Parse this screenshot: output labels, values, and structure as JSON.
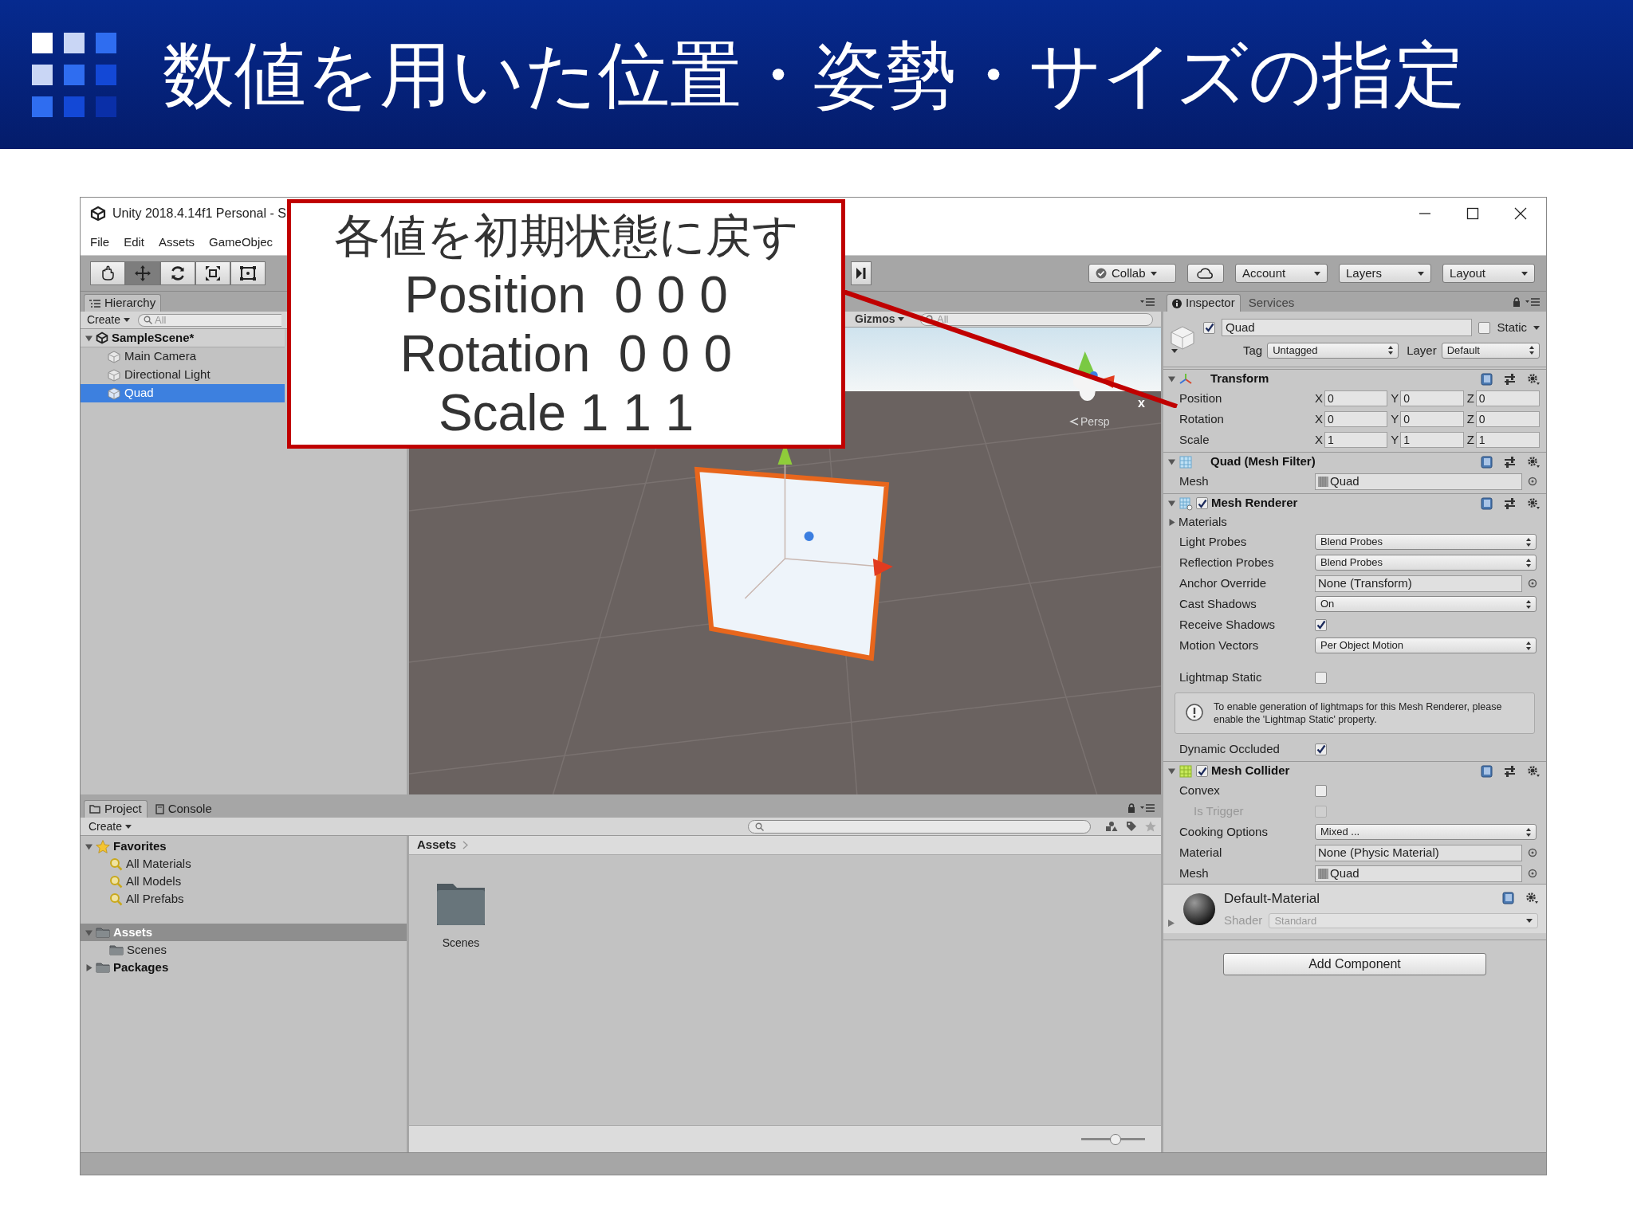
{
  "slide_title": "数値を用いた位置・姿勢・サイズの指定",
  "callout": {
    "lines": [
      "各値を初期状態に戻す",
      "Position  0 0 0",
      "Rotation  0 0 0",
      "Scale 1 1 1"
    ]
  },
  "window": {
    "title": "Unity 2018.4.14f1 Personal - S",
    "menu": [
      "File",
      "Edit",
      "Assets",
      "GameObjec"
    ]
  },
  "toolbar": {
    "tools": [
      {
        "kind": "hand",
        "selected": false
      },
      {
        "kind": "move",
        "selected": true
      },
      {
        "kind": "rotate",
        "selected": false
      },
      {
        "kind": "scale",
        "selected": false
      },
      {
        "kind": "rect",
        "selected": false
      }
    ],
    "right_buttons": [
      {
        "kind": "collab",
        "label": "Collab"
      },
      {
        "kind": "cloud"
      },
      {
        "kind": "dropdown",
        "label": "Account"
      },
      {
        "kind": "dropdown",
        "label": "Layers"
      },
      {
        "kind": "dropdown",
        "label": "Layout"
      }
    ]
  },
  "hierarchy": {
    "tab": "Hierarchy",
    "create": "Create",
    "search_placeholder": "All",
    "scene": "SampleScene*",
    "items": [
      {
        "label": "Main Camera",
        "selected": false
      },
      {
        "label": "Directional Light",
        "selected": false
      },
      {
        "label": "Quad",
        "selected": true
      }
    ]
  },
  "scene_view": {
    "gizmos": "Gizmos",
    "search_placeholder": "All",
    "camera_label": "Persp",
    "axis_label": "x"
  },
  "inspector": {
    "tabs": [
      {
        "label": "Inspector",
        "selected": true
      },
      {
        "label": "Services",
        "selected": false
      }
    ],
    "object": {
      "name": "Quad",
      "active": true,
      "static_label": "Static",
      "static": false,
      "tag_label": "Tag",
      "tag": "Untagged",
      "layer_label": "Layer",
      "layer": "Default"
    },
    "components": [
      {
        "kind": "transform",
        "title": "Transform",
        "rows": [
          {
            "label": "Position",
            "axes": [
              "X",
              "Y",
              "Z"
            ],
            "values": [
              "0",
              "0",
              "0"
            ]
          },
          {
            "label": "Rotation",
            "axes": [
              "X",
              "Y",
              "Z"
            ],
            "values": [
              "0",
              "0",
              "0"
            ]
          },
          {
            "label": "Scale",
            "axes": [
              "X",
              "Y",
              "Z"
            ],
            "values": [
              "1",
              "1",
              "1"
            ]
          }
        ]
      },
      {
        "kind": "mesh_filter",
        "title": "Quad (Mesh Filter)",
        "fields": [
          {
            "kind": "asset",
            "label": "Mesh",
            "value": "Quad"
          }
        ]
      },
      {
        "kind": "mesh_renderer",
        "title": "Mesh Renderer",
        "enabled": true,
        "fields": [
          {
            "kind": "foldout",
            "label": "Materials"
          },
          {
            "kind": "dropdown",
            "label": "Light Probes",
            "value": "Blend Probes"
          },
          {
            "kind": "dropdown",
            "label": "Reflection Probes",
            "value": "Blend Probes"
          },
          {
            "kind": "object",
            "label": "Anchor Override",
            "value": "None (Transform)"
          },
          {
            "kind": "dropdown",
            "label": "Cast Shadows",
            "value": "On"
          },
          {
            "kind": "checkbox",
            "label": "Receive Shadows",
            "checked": true,
            "disabled": false
          },
          {
            "kind": "dropdown",
            "label": "Motion Vectors",
            "value": "Per Object Motion"
          },
          {
            "kind": "spacer"
          },
          {
            "kind": "checkbox",
            "label": "Lightmap Static",
            "checked": false,
            "disabled": false
          },
          {
            "kind": "help",
            "text": "To enable generation of lightmaps for this Mesh Renderer, please enable the 'Lightmap Static' property."
          },
          {
            "kind": "checkbox",
            "label": "Dynamic Occluded",
            "checked": true,
            "disabled": false
          }
        ]
      },
      {
        "kind": "mesh_collider",
        "title": "Mesh Collider",
        "enabled": true,
        "fields": [
          {
            "kind": "checkbox",
            "label": "Convex",
            "checked": false,
            "disabled": false
          },
          {
            "kind": "checkbox",
            "label": "Is Trigger",
            "checked": false,
            "disabled": true
          },
          {
            "kind": "dropdown",
            "label": "Cooking Options",
            "value": "Mixed ..."
          },
          {
            "kind": "object",
            "label": "Material",
            "value": "None (Physic Material)"
          },
          {
            "kind": "asset",
            "label": "Mesh",
            "value": "Quad"
          }
        ]
      },
      {
        "kind": "material",
        "title": "Default-Material",
        "shader_label": "Shader",
        "shader": "Standard"
      }
    ],
    "add_component": "Add Component"
  },
  "project": {
    "tabs": [
      {
        "label": "Project",
        "selected": true
      },
      {
        "label": "Console",
        "selected": false
      }
    ],
    "create": "Create",
    "tree": [
      {
        "kind": "favorites",
        "label": "Favorites",
        "expanded": true,
        "selected": false,
        "children": [
          {
            "label": "All Materials",
            "selected": false
          },
          {
            "label": "All Models",
            "selected": false
          },
          {
            "label": "All Prefabs",
            "selected": false
          }
        ]
      },
      {
        "kind": "folder",
        "label": "Assets",
        "expanded": true,
        "selected": true,
        "children": [
          {
            "label": "Scenes",
            "selected": false
          }
        ]
      },
      {
        "kind": "folder",
        "label": "Packages",
        "expanded": false,
        "selected": false
      }
    ],
    "breadcrumb": "Assets",
    "assets": [
      {
        "label": "Scenes"
      }
    ],
    "zoom_slider": {
      "level": 0.55
    }
  }
}
